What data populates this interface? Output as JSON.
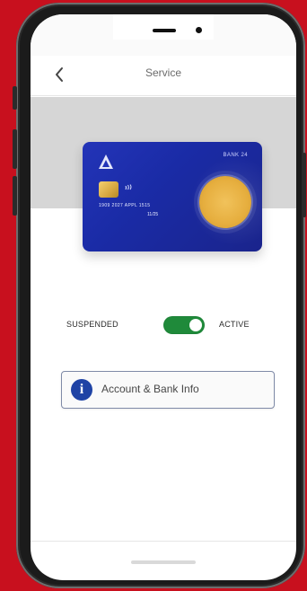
{
  "nav": {
    "title": "Service"
  },
  "card": {
    "brand": "BANK 24",
    "number": "1909 2027 APPL 1515",
    "expiry": "11/25"
  },
  "status": {
    "left_label": "SUSPENDED",
    "right_label": "ACTIVE",
    "toggle_on": true
  },
  "info": {
    "label": "Account & Bank Info"
  },
  "colors": {
    "frame_bg": "#c8101e",
    "toggle_on": "#1f8a3a",
    "card_primary": "#2334b8",
    "info_icon": "#1f43a5"
  },
  "icons": {
    "back": "chevron-left",
    "info": "info-circle",
    "contactless": "contactless",
    "card_logo": "triangle-logo"
  }
}
